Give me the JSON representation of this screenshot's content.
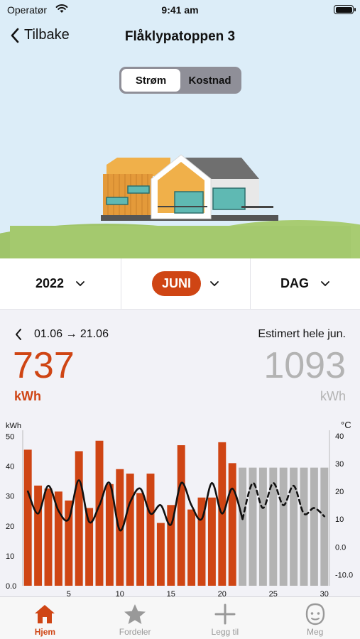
{
  "status": {
    "carrier": "Operatør",
    "time": "9:41 am"
  },
  "nav": {
    "back_label": "Tilbake",
    "title": "Flåklypatoppen 3"
  },
  "segment": {
    "options": [
      "Strøm",
      "Kostnad"
    ],
    "selected": "Strøm"
  },
  "selectors": {
    "year": "2022",
    "month": "JUNI",
    "resolution": "DAG"
  },
  "summary": {
    "range": "01.06 → 21.06",
    "estimate_label": "Estimert hele jun.",
    "used_value": "737",
    "used_unit": "kWh",
    "estimate_value": "1093",
    "estimate_unit": "kWh"
  },
  "colors": {
    "accent": "#cf4514",
    "estimate": "#b3b3b3",
    "sky": "#dcedf8",
    "grass": "#9fc46a"
  },
  "tabs": [
    {
      "label": "Hjem",
      "icon": "home-icon",
      "active": true
    },
    {
      "label": "Fordeler",
      "icon": "star-icon",
      "active": false
    },
    {
      "label": "Legg til",
      "icon": "plus-icon",
      "active": false
    },
    {
      "label": "Meg",
      "icon": "face-icon",
      "active": false
    }
  ],
  "chart_data": {
    "type": "bar",
    "left_axis_label": "kWh",
    "right_axis_label": "°C",
    "ylim": [
      0,
      52
    ],
    "y2lim": [
      -14,
      42
    ],
    "yticks": [
      "0.0",
      "10",
      "20",
      "30",
      "40",
      "50"
    ],
    "y2ticks": [
      "-10.0",
      "0.0",
      "10",
      "20",
      "30",
      "40"
    ],
    "xticks": [
      "5",
      "10",
      "15",
      "20",
      "25",
      "30"
    ],
    "grid": false,
    "series": [
      {
        "name": "",
        "kind": "actual",
        "x": [
          1,
          2,
          3,
          4,
          5,
          6,
          7,
          8,
          9,
          10,
          11,
          12,
          13,
          14,
          15,
          16,
          17,
          18,
          19,
          20,
          21
        ],
        "values": [
          45.5,
          33.5,
          32.5,
          31.5,
          28.5,
          45,
          26,
          48.5,
          34,
          39,
          37.5,
          31,
          37.5,
          21,
          27,
          47,
          25.5,
          29.5,
          29.5,
          48,
          41
        ]
      },
      {
        "name": "",
        "kind": "estimated",
        "x": [
          22,
          23,
          24,
          25,
          26,
          27,
          28,
          29,
          30
        ],
        "values": [
          39.5,
          39.5,
          39.5,
          39.5,
          39.5,
          39.5,
          39.5,
          39.5,
          39.5
        ]
      }
    ],
    "temperature": {
      "axis": "right",
      "x": [
        1,
        2,
        3,
        4,
        5,
        6,
        7,
        8,
        9,
        10,
        11,
        12,
        13,
        14,
        15,
        16,
        17,
        18,
        19,
        20,
        21,
        22,
        23,
        24,
        25,
        26,
        27,
        28,
        29,
        30
      ],
      "values": [
        20,
        12,
        22,
        13,
        10,
        24,
        9,
        15,
        23,
        6,
        16,
        21,
        12,
        15,
        8,
        23,
        15,
        10,
        23,
        12,
        21,
        10,
        23,
        14,
        23,
        15,
        22,
        12,
        14,
        11
      ],
      "forecast_from": 22
    }
  }
}
